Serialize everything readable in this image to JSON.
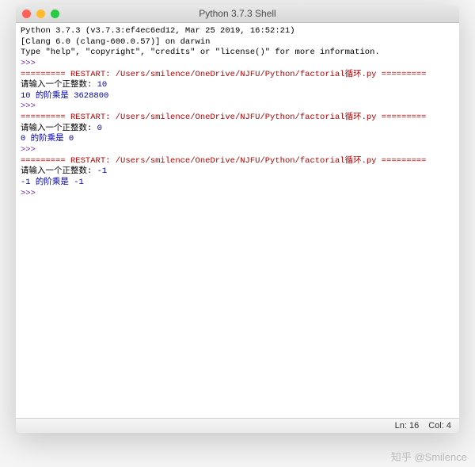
{
  "window": {
    "title": "Python 3.7.3 Shell"
  },
  "shell": {
    "header1": "Python 3.7.3 (v3.7.3:ef4ec6ed12, Mar 25 2019, 16:52:21) ",
    "header2": "[Clang 6.0 (clang-600.0.57)] on darwin",
    "header3": "Type \"help\", \"copyright\", \"credits\" or \"license()\" for more information.",
    "prompt": ">>> ",
    "restart_line": "========= RESTART: /Users/smilence/OneDrive/NJFU/Python/factorial循环.py =========",
    "run1_input_label": "请输入一个正整数: ",
    "run1_input_value": "10",
    "run1_output": "10 的阶乘是 3628800",
    "run2_input_label": "请输入一个正整数: ",
    "run2_input_value": "0",
    "run2_output": "0 的阶乘是 0",
    "run3_input_label": "请输入一个正整数: ",
    "run3_input_value": "-1",
    "run3_output": "-1 的阶乘是 -1"
  },
  "status": {
    "line_label": "Ln: ",
    "line": "16",
    "col_label": "Col: ",
    "col": "4"
  },
  "watermark": "知乎 @Smilence"
}
